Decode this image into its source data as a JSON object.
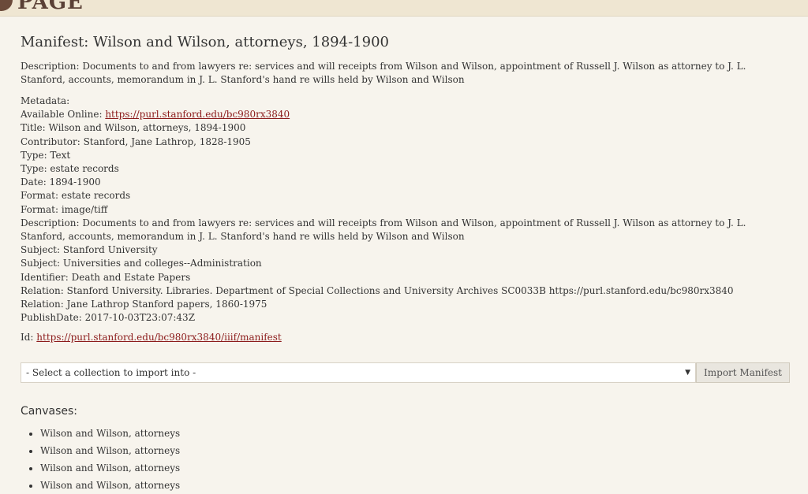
{
  "header": {
    "logo_text": "PAGE"
  },
  "manifest": {
    "title": "Manifest: Wilson and Wilson, attorneys, 1894-1900",
    "description": "Description: Documents to and from lawyers re: services and will receipts from Wilson and Wilson, appointment of Russell J. Wilson as attorney to J. L. Stanford, accounts, memorandum in J. L. Stanford's hand re wills held by Wilson and Wilson"
  },
  "metadata": {
    "heading": "Metadata:",
    "available_online_label": "Available Online: ",
    "available_online_link": "https://purl.stanford.edu/bc980rx3840",
    "lines": [
      "Title: Wilson and Wilson, attorneys, 1894-1900",
      "Contributor: Stanford, Jane Lathrop, 1828-1905",
      "Type: Text",
      "Type: estate records",
      "Date: 1894-1900",
      "Format: estate records",
      "Format: image/tiff",
      "Description: Documents to and from lawyers re: services and will receipts from Wilson and Wilson, appointment of Russell J. Wilson as attorney to J. L. Stanford, accounts, memorandum in J. L. Stanford's hand re wills held by Wilson and Wilson",
      "Subject: Stanford University",
      "Subject: Universities and colleges--Administration",
      "Identifier: Death and Estate Papers",
      "Relation: Stanford University. Libraries. Department of Special Collections and University Archives SC0033B https://purl.stanford.edu/bc980rx3840",
      "Relation: Jane Lathrop Stanford papers, 1860-1975",
      "PublishDate: 2017-10-03T23:07:43Z"
    ]
  },
  "id": {
    "label": "Id: ",
    "link": "https://purl.stanford.edu/bc980rx3840/iiif/manifest"
  },
  "import": {
    "select_value": "- Select a collection to import into -",
    "button_label": "Import Manifest"
  },
  "canvases": {
    "heading": "Canvases:",
    "items": [
      "Wilson and Wilson, attorneys",
      "Wilson and Wilson, attorneys",
      "Wilson and Wilson, attorneys",
      "Wilson and Wilson, attorneys"
    ]
  }
}
